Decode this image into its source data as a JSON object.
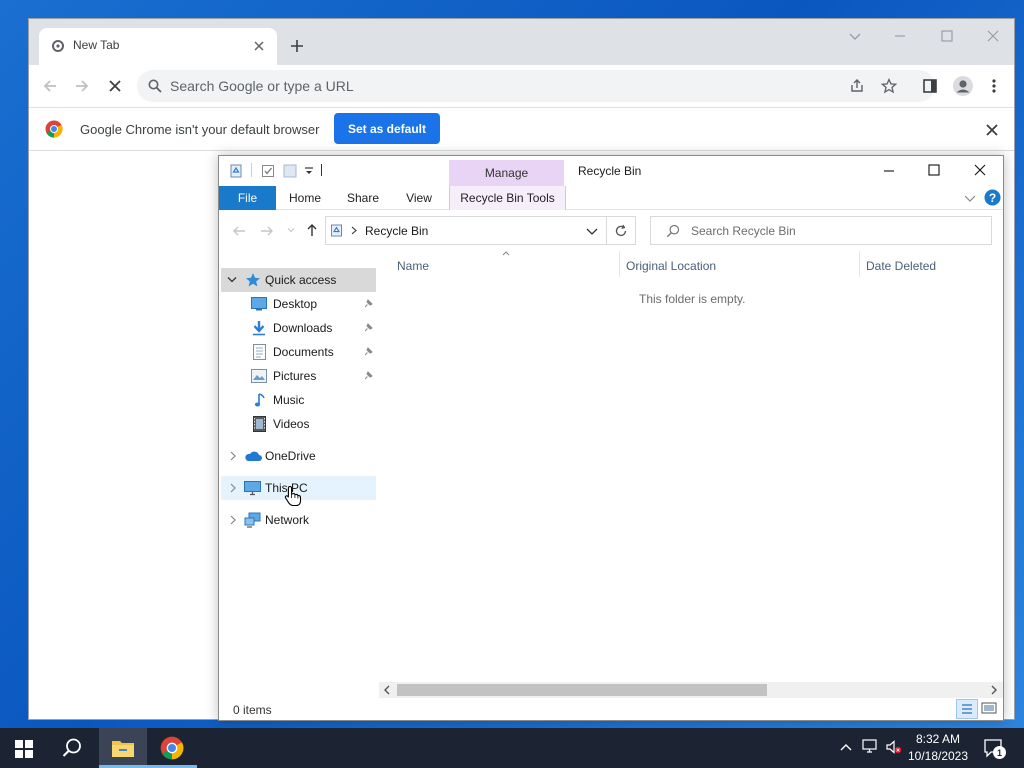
{
  "chrome": {
    "tab_title": "New Tab",
    "omnibox_placeholder": "Search Google or type a URL",
    "infobar_message": "Google Chrome isn't your default browser",
    "set_default_label": "Set as default"
  },
  "explorer": {
    "window_title": "Recycle Bin",
    "contextual_group_label": "Manage",
    "ribbon_tabs": {
      "file": "File",
      "home": "Home",
      "share": "Share",
      "view": "View",
      "tools": "Recycle Bin Tools"
    },
    "address_path": "Recycle Bin",
    "search_placeholder": "Search Recycle Bin",
    "nav": {
      "quick_access": "Quick access",
      "desktop": "Desktop",
      "downloads": "Downloads",
      "documents": "Documents",
      "pictures": "Pictures",
      "music": "Music",
      "videos": "Videos",
      "onedrive": "OneDrive",
      "this_pc": "This PC",
      "network": "Network"
    },
    "columns": [
      "Name",
      "Original Location",
      "Date Deleted"
    ],
    "empty_message": "This folder is empty.",
    "status_items": "0 items"
  },
  "taskbar": {
    "time": "8:32 AM",
    "date": "10/18/2023",
    "notification_count": "1"
  },
  "colors": {
    "accent": "#1a73e8",
    "file_tab": "#1979ca",
    "manage_tab": "#ead4f5",
    "taskbar": "#1c2433"
  }
}
